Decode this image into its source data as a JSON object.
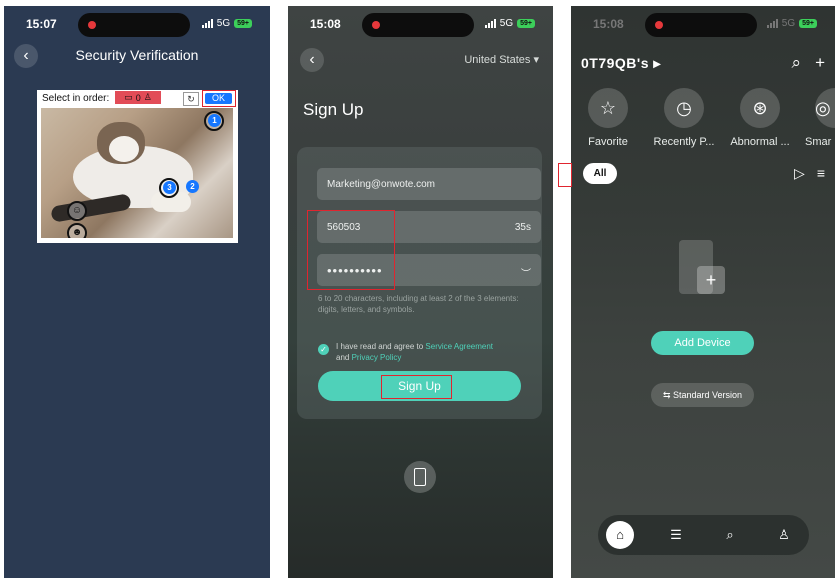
{
  "screen1": {
    "time": "15:07",
    "network": "5G",
    "battery": "59+",
    "title": "Security Verification",
    "captcha": {
      "instruction": "Select in order:",
      "count": "0",
      "ok_label": "OK",
      "markers": [
        "1",
        "2",
        "3"
      ]
    }
  },
  "screen2": {
    "time": "15:08",
    "network": "5G",
    "battery": "59+",
    "region": "United States",
    "title": "Sign Up",
    "email": "Marketing@onwote.com",
    "code": "560503",
    "countdown": "35s",
    "password": "••••••••••",
    "hint": "6 to 20 characters, including at least 2 of the 3 elements: digits, letters, and symbols.",
    "agree_prefix": "I have read and agree to",
    "service_agreement": "Service Agreement",
    "and": "and",
    "privacy_policy": "Privacy Policy",
    "signup_button": "Sign Up"
  },
  "screen3": {
    "time": "15:08",
    "network": "5G",
    "battery": "59+",
    "home_name": "0T79QB's",
    "categories": [
      {
        "label": "Favorite",
        "icon": "star-icon"
      },
      {
        "label": "Recently P...",
        "icon": "clock-icon"
      },
      {
        "label": "Abnormal ...",
        "icon": "pulse-icon"
      },
      {
        "label": "Smar",
        "icon": "smart-icon"
      }
    ],
    "all_pill": "All",
    "add_device": "Add Device",
    "standard_version": "Standard Version"
  },
  "colors": {
    "accent": "#4fd1b9",
    "captcha_blue": "#1677ff",
    "highlight_red": "#e0252f"
  }
}
